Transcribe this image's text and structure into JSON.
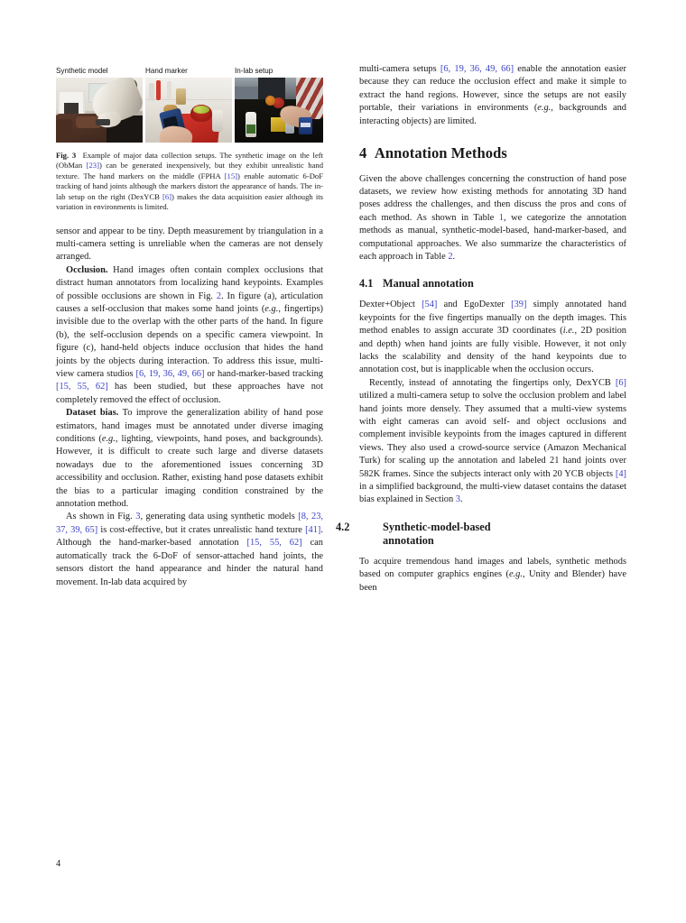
{
  "page": {
    "number": "4"
  },
  "figure": {
    "panels": [
      {
        "label": "Synthetic model",
        "image_name": "synthetic-living-room-hand"
      },
      {
        "label": "Hand marker",
        "image_name": "kitchen-hand-marker-device"
      },
      {
        "label": "In-lab setup",
        "image_name": "in-lab-tabletop-ycb-objects"
      }
    ],
    "caption_prefix": "Fig. 3",
    "caption_parts": [
      {
        "t": "text",
        "v": "Example of major data collection setups. The synthetic image on the left (ObMan "
      },
      {
        "t": "ref",
        "v": "[23]"
      },
      {
        "t": "text",
        "v": ") can be generated inexpensively, but they exhibit unrealistic hand texture. The hand markers on the middle (FPHA "
      },
      {
        "t": "ref",
        "v": "[15]"
      },
      {
        "t": "text",
        "v": ") enable automatic 6-DoF tracking of hand joints although the markers distort the appearance of hands. The in-lab setup on the right (DexYCB "
      },
      {
        "t": "ref",
        "v": "[6]"
      },
      {
        "t": "text",
        "v": ") makes the data acquisition easier although its variation in environments is limited."
      }
    ]
  },
  "left_column": {
    "paragraphs": [
      {
        "name": "paragraph-depth-sensor-continued",
        "indent": false,
        "parts": [
          {
            "t": "text",
            "v": "sensor and appear to be tiny. Depth measurement by triangulation in a multi-camera setting is unreliable when the cameras are not densely arranged."
          }
        ]
      },
      {
        "name": "paragraph-occlusion",
        "indent": true,
        "parts": [
          {
            "t": "bold",
            "v": "Occlusion."
          },
          {
            "t": "text",
            "v": " Hand images often contain complex occlusions that distract human annotators from localizing hand keypoints. Examples of possible occlusions are shown in Fig. "
          },
          {
            "t": "ref",
            "v": "2"
          },
          {
            "t": "text",
            "v": ". In figure (a), articulation causes a self-occlusion that makes some hand joints ("
          },
          {
            "t": "ital",
            "v": "e.g."
          },
          {
            "t": "text",
            "v": ", fingertips) invisible due to the overlap with the other parts of the hand. In figure (b), the self-occlusion depends on a specific camera viewpoint. In figure (c), hand-held objects induce occlusion that hides the hand joints by the objects during interaction. To address this issue, multi-view camera studios "
          },
          {
            "t": "ref",
            "v": "[6, 19, 36, 49, 66]"
          },
          {
            "t": "text",
            "v": " or hand-marker-based tracking "
          },
          {
            "t": "ref",
            "v": "[15, 55, 62]"
          },
          {
            "t": "text",
            "v": " has been studied, but these approaches have not completely removed the effect of occlusion."
          }
        ]
      },
      {
        "name": "paragraph-dataset-bias",
        "indent": true,
        "parts": [
          {
            "t": "bold",
            "v": "Dataset bias."
          },
          {
            "t": "text",
            "v": " To improve the generalization ability of hand pose estimators, hand images must be annotated under diverse imaging conditions ("
          },
          {
            "t": "ital",
            "v": "e.g."
          },
          {
            "t": "text",
            "v": ", lighting, viewpoints, hand poses, and backgrounds). However, it is difficult to create such large and diverse datasets nowadays due to the aforementioned issues concerning 3D accessibility and occlusion. Rather, existing hand pose datasets exhibit the bias to a particular imaging condition constrained by the annotation method."
          }
        ]
      },
      {
        "name": "paragraph-synthetic-models",
        "indent": true,
        "parts": [
          {
            "t": "text",
            "v": "As shown in Fig. "
          },
          {
            "t": "ref",
            "v": "3"
          },
          {
            "t": "text",
            "v": ", generating data using synthetic models "
          },
          {
            "t": "ref",
            "v": "[8, 23, 37, 39, 65]"
          },
          {
            "t": "text",
            "v": " is cost-effective, but it crates unrealistic hand texture "
          },
          {
            "t": "ref",
            "v": "[41]"
          },
          {
            "t": "text",
            "v": ". Although the hand-marker-based annotation "
          },
          {
            "t": "ref",
            "v": "[15, 55, 62]"
          },
          {
            "t": "text",
            "v": " can automatically track the 6-DoF of sensor-attached hand joints, the sensors distort the hand appearance and hinder the natural hand movement. In-lab data acquired by"
          }
        ]
      }
    ]
  },
  "right_column": {
    "paragraph_intro": {
      "name": "paragraph-multi-camera-setups",
      "parts": [
        {
          "t": "text",
          "v": "multi-camera setups "
        },
        {
          "t": "ref",
          "v": "[6, 19, 36, 49, 66]"
        },
        {
          "t": "text",
          "v": " enable the annotation easier because they can reduce the occlusion effect and make it simple to extract the hand regions. However, since the setups are not easily portable, their variations in environments ("
        },
        {
          "t": "ital",
          "v": "e.g."
        },
        {
          "t": "text",
          "v": ", backgrounds and interacting objects) are limited."
        }
      ]
    },
    "section": {
      "number": "4",
      "title": "Annotation Methods",
      "intro": {
        "name": "paragraph-annotation-methods-intro",
        "parts": [
          {
            "t": "text",
            "v": "Given the above challenges concerning the construction of hand pose datasets, we review how existing methods for annotating 3D hand poses address the challenges, and then discuss the pros and cons of each method. As shown in Table "
          },
          {
            "t": "ref",
            "v": "1"
          },
          {
            "t": "text",
            "v": ", we categorize the annotation methods as manual, synthetic-model-based, hand-marker-based, and computational approaches. We also summarize the characteristics of each approach in Table "
          },
          {
            "t": "ref",
            "v": "2"
          },
          {
            "t": "text",
            "v": "."
          }
        ]
      }
    },
    "subsection_1": {
      "number": "4.1",
      "title": "Manual annotation",
      "paragraphs": [
        {
          "name": "paragraph-manual-annotation-1",
          "indent": false,
          "parts": [
            {
              "t": "text",
              "v": "Dexter+Object "
            },
            {
              "t": "ref",
              "v": "[54]"
            },
            {
              "t": "text",
              "v": " and EgoDexter "
            },
            {
              "t": "ref",
              "v": "[39]"
            },
            {
              "t": "text",
              "v": " simply annotated hand keypoints for the five fingertips manually on the depth images. This method enables to assign accurate 3D coordinates ("
            },
            {
              "t": "ital",
              "v": "i.e."
            },
            {
              "t": "text",
              "v": ", 2D position and depth) when hand joints are fully visible. However, it not only lacks the scalability and density of the hand keypoints due to annotation cost, but is inapplicable when the occlusion occurs."
            }
          ]
        },
        {
          "name": "paragraph-manual-annotation-2",
          "indent": true,
          "parts": [
            {
              "t": "text",
              "v": "Recently, instead of annotating the fingertips only, DexYCB "
            },
            {
              "t": "ref",
              "v": "[6]"
            },
            {
              "t": "text",
              "v": " utilized a multi-camera setup to solve the occlusion problem and label hand joints more densely. They assumed that a multi-view systems with eight cameras can avoid self- and object occlusions and complement invisible keypoints from the images captured in different views. They also used a crowd-source service (Amazon Mechanical Turk) for scaling up the annotation and labeled 21 hand joints over 582K frames. Since the subjects interact only with 20 YCB objects "
            },
            {
              "t": "ref",
              "v": "[4]"
            },
            {
              "t": "text",
              "v": " in a simplified background, the multi-view dataset contains the dataset bias explained in Section "
            },
            {
              "t": "ref",
              "v": "3"
            },
            {
              "t": "text",
              "v": "."
            }
          ]
        }
      ]
    },
    "subsection_2": {
      "number": "4.2",
      "title_line_1": "Synthetic-model-based",
      "title_line_2": "annotation",
      "paragraphs": [
        {
          "name": "paragraph-synthetic-model-based-1",
          "indent": false,
          "parts": [
            {
              "t": "text",
              "v": "To acquire tremendous hand images and labels, synthetic methods based on computer graphics engines ("
            },
            {
              "t": "ital",
              "v": "e.g."
            },
            {
              "t": "text",
              "v": ", Unity and Blender) have been"
            }
          ]
        }
      ]
    }
  },
  "colors": {
    "reference_link": "#3c42c4",
    "text": "#1a1a1a",
    "background": "#ffffff"
  }
}
